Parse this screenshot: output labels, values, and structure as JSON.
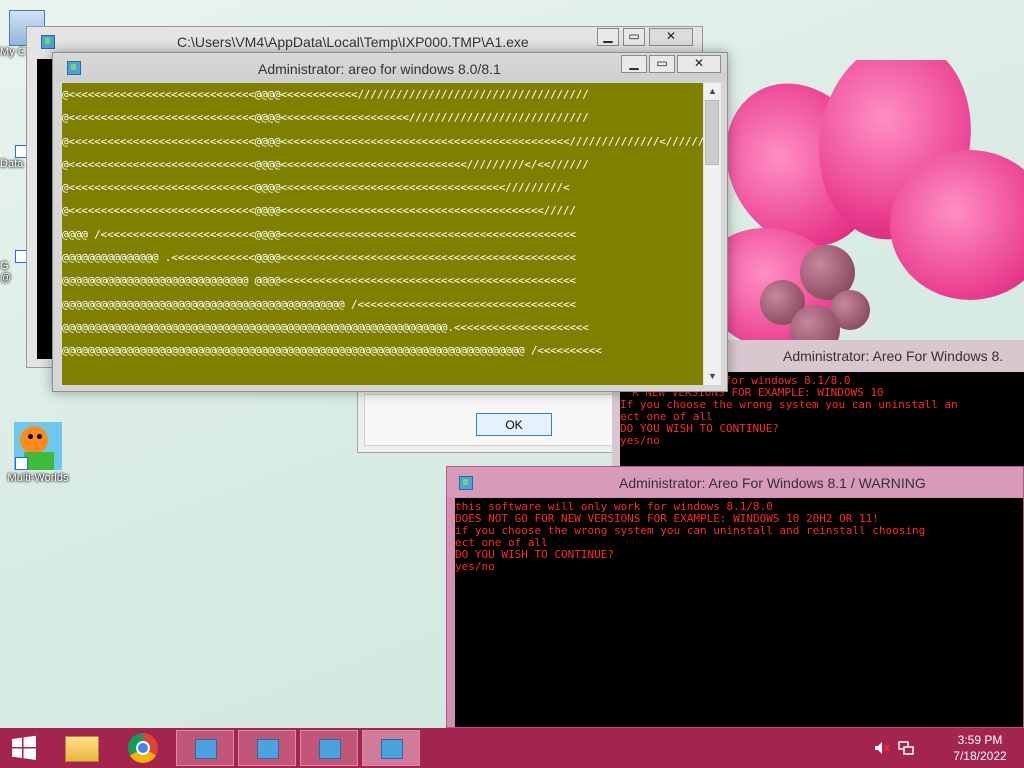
{
  "desktop": {
    "icons": [
      {
        "label": "My C",
        "icon": "computer-icon"
      },
      {
        "label": "Data",
        "icon": "shortcut-icon"
      },
      {
        "label": "G\n@",
        "icon": "chrome-icon"
      },
      {
        "label": "Multi-Worlds",
        "icon": "game-icon"
      }
    ]
  },
  "win_back": {
    "title": "C:\\Users\\VM4\\AppData\\Local\\Temp\\IXP000.TMP\\A1.exe",
    "minimize": "▁",
    "maximize": "▭",
    "close": "✕"
  },
  "win_main": {
    "title": "Administrator:  areo for windows 8.0/8.1",
    "minimize": "▁",
    "maximize": "▭",
    "close": "✕",
    "bg_color": "#808000",
    "lines": [
      "@<<<<<<<<<<<<<<<<<<<<<<<<<<<<<@@@@<<<<<<<<<<<<////////////////////////////////////",
      "@<<<<<<<<<<<<<<<<<<<<<<<<<<<<<@@@@<<<<<<<<<<<<<<<<<<<<////////////////////////////",
      "@<<<<<<<<<<<<<<<<<<<<<<<<<<<<<@@@@<<<<<<<<<<<<<<<<<<<<<<<<<<<<<<<<<<<<<<<<<<<<<//////////////<///////",
      "@<<<<<<<<<<<<<<<<<<<<<<<<<<<<<@@@@<<<<<<<<<<<<<<<<<<<<<<<<<<<<</////////</<<//////",
      "@<<<<<<<<<<<<<<<<<<<<<<<<<<<<<@@@@<<<<<<<<<<<<<<<<<<<<<<<<<<<<<<<<<<</////////<",
      "@<<<<<<<<<<<<<<<<<<<<<<<<<<<<<@@@@<<<<<<<<<<<<<<<<<<<<<<<<<<<<<<<<<<<<<<<<</////",
      "@@@@ /<<<<<<<<<<<<<<<<<<<<<<<<@@@@<<<<<<<<<<<<<<<<<<<<<<<<<<<<<<<<<<<<<<<<<<<<<<",
      "@@@@@@@@@@@@@@@ .<<<<<<<<<<<<<@@@@<<<<<<<<<<<<<<<<<<<<<<<<<<<<<<<<<<<<<<<<<<<<<<",
      "@@@@@@@@@@@@@@@@@@@@@@@@@@@@@ @@@@<<<<<<<<<<<<<<<<<<<<<<<<<<<<<<<<<<<<<<<<<<<<<<",
      "@@@@@@@@@@@@@@@@@@@@@@@@@@@@@@@@@@@@@@@@@@@@ /<<<<<<<<<<<<<<<<<<<<<<<<<<<<<<<<<<",
      "@@@@@@@@@@@@@@@@@@@@@@@@@@@@@@@@@@@@@@@@@@@@@@@@@@@@@@@@@@@@.<<<<<<<<<<<<<<<<<<<<<",
      "@@@@@@@@@@@@@@@@@@@@@@@@@@@@@@@@@@@@@@@@@@@@@@@@@@@@@@@@@@@@@@@@@@@@@@@@ /<<<<<<<<<<"
    ]
  },
  "dialog": {
    "ok_label": "OK"
  },
  "win_mid": {
    "title": "Administrator:  Areo For Windows 8.",
    "lines": [
      "ill only work for windows 8.1/8.0",
      "R NEW VERSIONS FOR EXAMPLE: WINDOWS 10",
      "If you choose the wrong system you can uninstall an",
      "ect one of all",
      "DO YOU WISH TO CONTINUE?",
      "yes/no"
    ]
  },
  "win_front": {
    "title": "Administrator:  Areo For Windows 8.1 / WARNING",
    "text_color": "#ff2a2a",
    "lines": [
      "this software will only work for windows 8.1/8.0",
      "DOES NOT GO FOR NEW VERSIONS FOR EXAMPLE: WINDOWS 10 20H2 OR 11!",
      "if you choose the wrong system you can uninstall and reinstall choosing",
      "ect one of all",
      "DO YOU WISH TO CONTINUE?",
      "yes/no"
    ]
  },
  "taskbar": {
    "bg_color": "#a3244f",
    "time": "3:59 PM",
    "date": "7/18/2022"
  }
}
